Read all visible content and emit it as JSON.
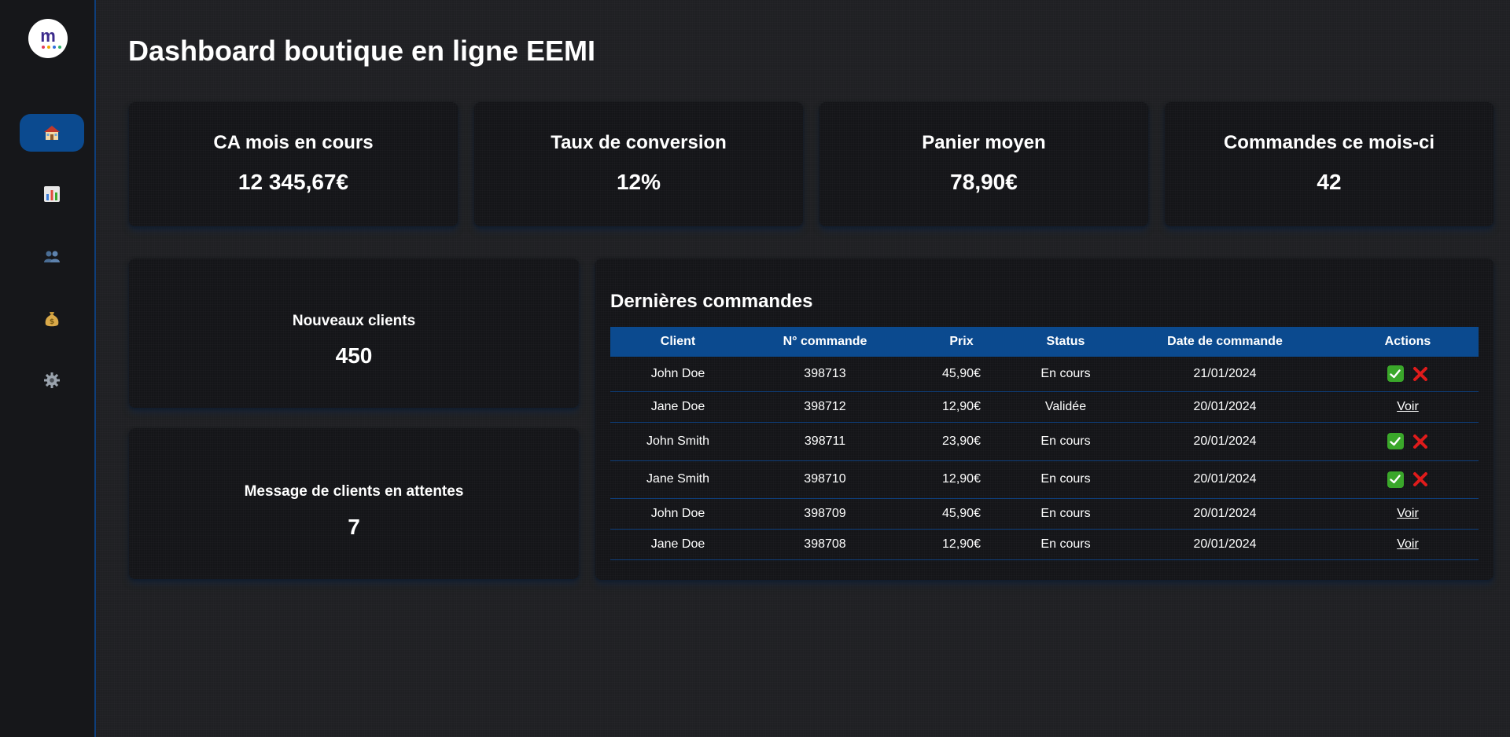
{
  "page": {
    "title": "Dashboard boutique en ligne EEMI"
  },
  "sidebar": {
    "logo_letter": "m",
    "items": [
      {
        "name": "home",
        "icon": "house-icon",
        "active": true
      },
      {
        "name": "stats",
        "icon": "bar-chart-icon",
        "active": false
      },
      {
        "name": "clients",
        "icon": "users-icon",
        "active": false
      },
      {
        "name": "finance",
        "icon": "money-bag-icon",
        "active": false
      },
      {
        "name": "settings",
        "icon": "gear-icon",
        "active": false
      }
    ]
  },
  "kpis": [
    {
      "label": "CA mois en cours",
      "value": "12 345,67€"
    },
    {
      "label": "Taux de conversion",
      "value": "12%"
    },
    {
      "label": "Panier moyen",
      "value": "78,90€"
    },
    {
      "label": "Commandes ce mois-ci",
      "value": "42"
    }
  ],
  "side_cards": [
    {
      "label": "Nouveaux clients",
      "value": "450"
    },
    {
      "label": "Message de clients en attentes",
      "value": "7"
    }
  ],
  "orders": {
    "title": "Dernières commandes",
    "columns": [
      "Client",
      "N° commande",
      "Prix",
      "Status",
      "Date de commande",
      "Actions"
    ],
    "view_label": "Voir",
    "rows": [
      {
        "client": "John Doe",
        "number": "398713",
        "price": "45,90€",
        "status": "En cours",
        "date": "21/01/2024",
        "action": "approve-reject"
      },
      {
        "client": "Jane Doe",
        "number": "398712",
        "price": "12,90€",
        "status": "Validée",
        "date": "20/01/2024",
        "action": "view"
      },
      {
        "client": "John Smith",
        "number": "398711",
        "price": "23,90€",
        "status": "En cours",
        "date": "20/01/2024",
        "action": "approve-reject"
      },
      {
        "client": "Jane Smith",
        "number": "398710",
        "price": "12,90€",
        "status": "En cours",
        "date": "20/01/2024",
        "action": "approve-reject"
      },
      {
        "client": "John Doe",
        "number": "398709",
        "price": "45,90€",
        "status": "En cours",
        "date": "20/01/2024",
        "action": "view"
      },
      {
        "client": "Jane Doe",
        "number": "398708",
        "price": "12,90€",
        "status": "En cours",
        "date": "20/01/2024",
        "action": "view"
      }
    ]
  },
  "colors": {
    "accent": "#0b4a8f",
    "approve": "#3aa72a",
    "reject": "#e01b1b"
  }
}
